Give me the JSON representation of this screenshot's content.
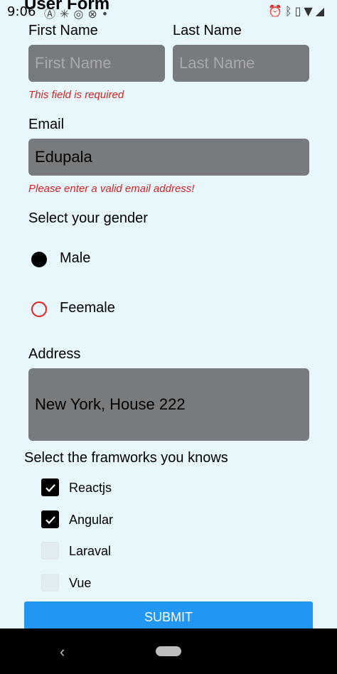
{
  "status_bar": {
    "time": "9:06",
    "left_icons": [
      "a-icon",
      "asterisk-icon",
      "target-icon",
      "at-icon",
      "dot-icon"
    ],
    "right_icons": [
      "alarm-icon",
      "bluetooth-icon",
      "vibrate-icon",
      "wifi-icon",
      "signal-icon"
    ]
  },
  "header": {
    "title": "User Form"
  },
  "form": {
    "first_name": {
      "label": "First Name",
      "placeholder": "First Name",
      "value": "",
      "error": "This field is required"
    },
    "last_name": {
      "label": "Last Name",
      "placeholder": "Last Name",
      "value": ""
    },
    "email": {
      "label": "Email",
      "value": "Edupala",
      "error": "Please enter a valid email address!"
    },
    "gender": {
      "label": "Select your gender",
      "options": [
        {
          "label": "Male",
          "selected": true
        },
        {
          "label": "Feemale",
          "selected": false
        }
      ]
    },
    "address": {
      "label": "Address",
      "value": "New York, House 222"
    },
    "frameworks": {
      "label": "Select the framworks you knows",
      "options": [
        {
          "label": "Reactjs",
          "checked": true
        },
        {
          "label": "Angular",
          "checked": true
        },
        {
          "label": "Laraval",
          "checked": false
        },
        {
          "label": "Vue",
          "checked": false
        }
      ]
    },
    "submit_label": "Submit"
  },
  "colors": {
    "background": "#e8f7fc",
    "input_bg": "#787b7d",
    "error": "#d32222",
    "submit_bg": "#2196f3"
  }
}
